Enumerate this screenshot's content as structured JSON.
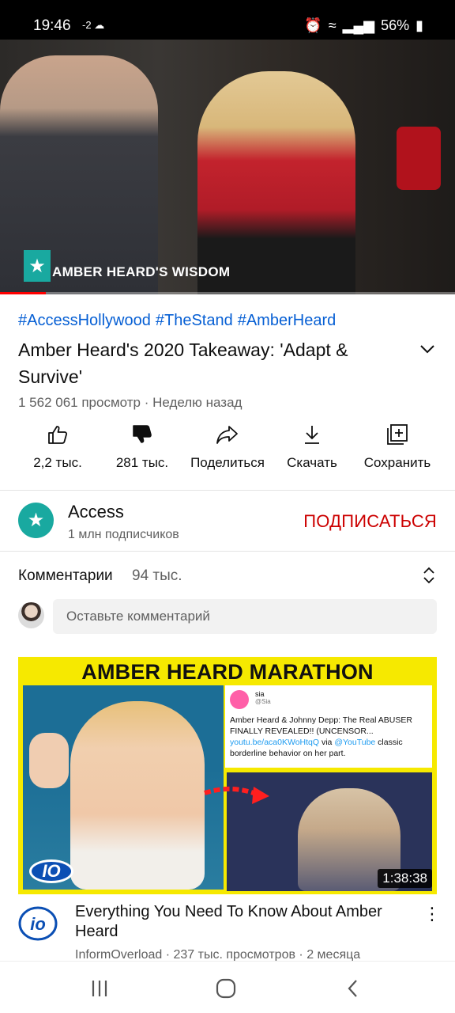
{
  "status_bar": {
    "time": "19:46",
    "left_extra": "-2",
    "battery": "56%"
  },
  "player": {
    "caption": "AMBER HEARD'S WISDOM",
    "progress_fraction": 0.1,
    "progress_color": "#ff0000"
  },
  "video": {
    "hashtags": [
      "#AccessHollywood",
      "#TheStand",
      "#AmberHeard"
    ],
    "title": "Amber Heard's 2020 Takeaway: 'Adapt & Survive'",
    "meta": "1 562 061 просмотр · Неделю назад"
  },
  "actions": [
    {
      "icon": "thumbs-up-icon",
      "label": "2,2 тыс."
    },
    {
      "icon": "thumbs-down-icon",
      "label": "281 тыс."
    },
    {
      "icon": "share-icon",
      "label": "Поделиться"
    },
    {
      "icon": "download-icon",
      "label": "Скачать"
    },
    {
      "icon": "save-to-playlist-icon",
      "label": "Сохранить"
    }
  ],
  "channel": {
    "name": "Access",
    "subscribers": "1 млн подписчиков",
    "subscribe_label": "ПОДПИСАТЬСЯ",
    "subscribe_color": "#cc0000"
  },
  "comments": {
    "heading": "Комментарии",
    "count": "94 тыс.",
    "placeholder": "Оставьте комментарий"
  },
  "next_video": {
    "thumbnail_banner": "AMBER HEARD MARATHON",
    "tweet_user": "sia",
    "tweet_handle": "@Sia",
    "tweet_text": "Amber Heard & Johnny Depp:  The Real ABUSER FINALLY REVEALED!! (UNCENSOR...",
    "tweet_link": "youtu.be/aca0KWoHtqQ",
    "tweet_via": "via",
    "tweet_via_account": "@YouTube",
    "tweet_tail": "classic borderline behavior on her part.",
    "logo_text": "IO",
    "duration": "1:38:38",
    "title": "Everything You Need To Know About Amber Heard",
    "meta": "InformOverload · 237 тыс. просмотров · 2 месяца"
  }
}
